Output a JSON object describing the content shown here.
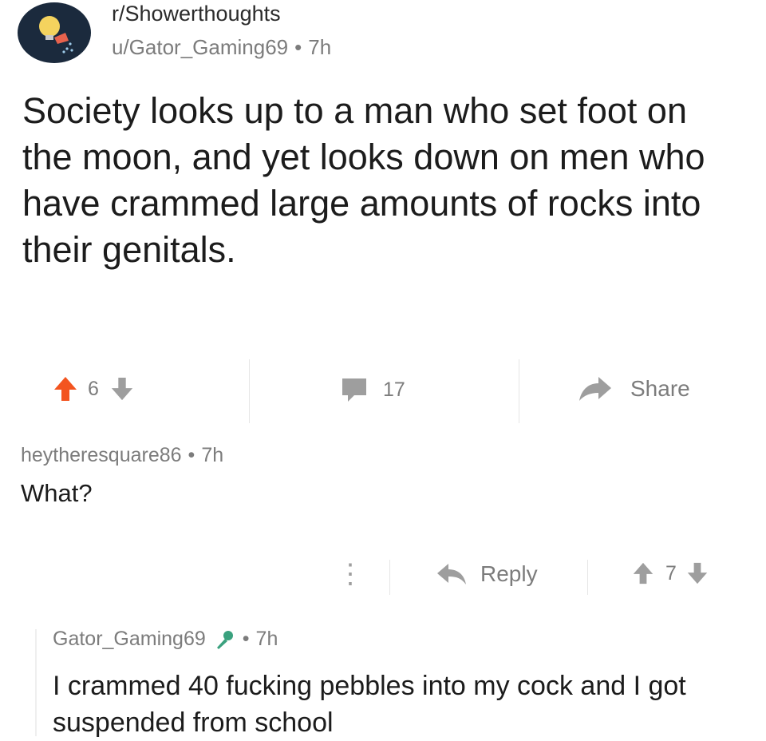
{
  "post": {
    "subreddit": "r/Showerthoughts",
    "author": "u/Gator_Gaming69",
    "separator": "•",
    "age": "7h",
    "title": "Society looks up to a man who set foot on the moon, and yet looks down on men who have crammed large amounts of rocks into their genitals.",
    "votes": "6",
    "comment_count": "17",
    "share_label": "Share"
  },
  "comment": {
    "author": "heytheresquare86",
    "separator": "•",
    "age": "7h",
    "body": "What?",
    "more_icon": "⋮",
    "reply_label": "Reply",
    "votes": "7"
  },
  "reply": {
    "author": "Gator_Gaming69",
    "separator": "•",
    "age": "7h",
    "body": "I crammed 40 fucking pebbles into my cock and I got suspended from school"
  },
  "colors": {
    "upvote_active": "#f3541f",
    "text": "#1c1c1c",
    "muted": "#7c7c7c",
    "avatar_bg": "#1b2a3d",
    "op_flair": "#3aa17e"
  },
  "icons": {
    "subreddit_avatar": "lightbulb-shower-icon",
    "upvote": "arrow-up-icon",
    "downvote": "arrow-down-icon",
    "comments": "speech-bubble-icon",
    "share": "share-arrow-icon",
    "reply": "reply-arrow-icon",
    "op_flair": "microphone-icon"
  }
}
